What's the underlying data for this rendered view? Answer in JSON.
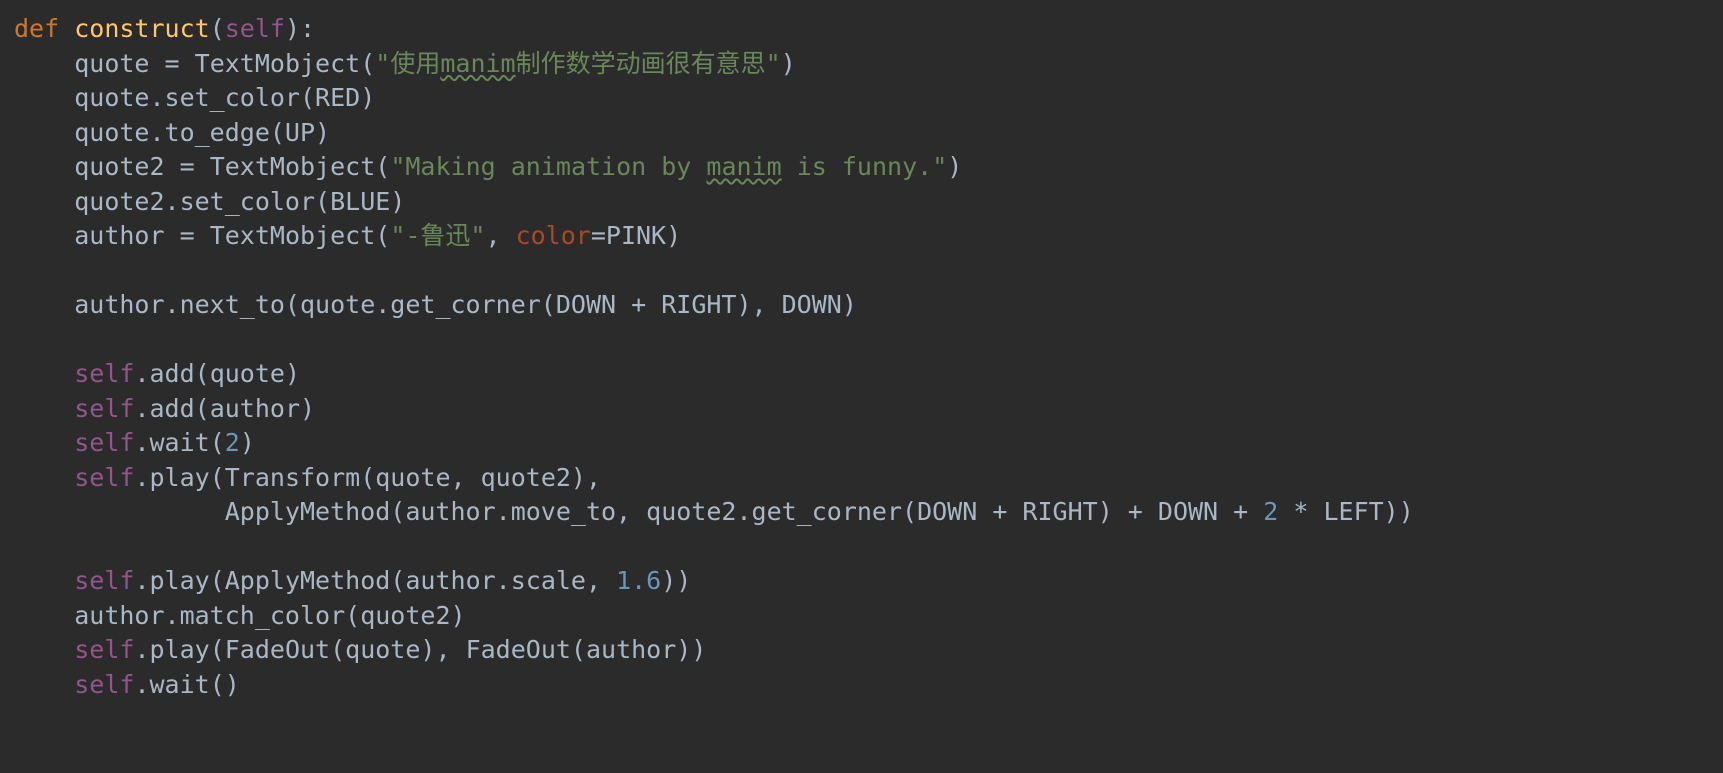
{
  "code": {
    "l1": {
      "kw": "def ",
      "fn": "construct",
      "p1": "(",
      "self": "self",
      "p2": "):"
    },
    "l2": {
      "indent": "    ",
      "v": "quote ",
      "eq": "=",
      "sp": " TextMobject(",
      "s_open": "\"",
      "s_a": "使用",
      "s_squig": "manim",
      "s_b": "制作数学动画很有意思",
      "s_close": "\"",
      "p": ")"
    },
    "l3": {
      "indent": "    ",
      "txt": "quote.set_color(RED)"
    },
    "l4": {
      "indent": "    ",
      "txt": "quote.to_edge(UP)"
    },
    "l5": {
      "indent": "    ",
      "v": "quote2 ",
      "eq": "=",
      "sp": " TextMobject(",
      "s_open": "\"",
      "s_a": "Making animation by ",
      "s_squig": "manim",
      "s_b": " is funny.",
      "s_close": "\"",
      "p": ")"
    },
    "l6": {
      "indent": "    ",
      "txt": "quote2.set_color(BLUE)"
    },
    "l7": {
      "indent": "    ",
      "v": "author ",
      "eq": "=",
      "sp": " TextMobject(",
      "s1": "\"-鲁迅\"",
      "comma": ", ",
      "kwarg": "color",
      "eq2": "=",
      "val": "PINK)"
    },
    "l8": {
      "blank": ""
    },
    "l9": {
      "indent": "    ",
      "txt": "author.next_to(quote.get_corner(DOWN + RIGHT), DOWN)"
    },
    "l10": {
      "blank": ""
    },
    "l11": {
      "indent": "    ",
      "self": "self",
      "rest": ".add(quote)"
    },
    "l12": {
      "indent": "    ",
      "self": "self",
      "rest": ".add(author)"
    },
    "l13": {
      "indent": "    ",
      "self": "self",
      "rest": ".wait(",
      "num": "2",
      "p": ")"
    },
    "l14": {
      "indent": "    ",
      "self": "self",
      "rest": ".play(Transform(quote, quote2),"
    },
    "l15": {
      "indent": "              ",
      "txt": "ApplyMethod(author.move_to, quote2.get_corner(DOWN + RIGHT) + DOWN + ",
      "num": "2",
      "rest2": " * LEFT))"
    },
    "l16": {
      "blank": ""
    },
    "l17": {
      "indent": "    ",
      "self": "self",
      "rest": ".play(ApplyMethod(author.scale, ",
      "num": "1.6",
      "p": "))"
    },
    "l18": {
      "indent": "    ",
      "txt": "author.match_color(quote2)"
    },
    "l19": {
      "indent": "    ",
      "self": "self",
      "rest": ".play(FadeOut(quote), FadeOut(author))"
    },
    "l20": {
      "indent": "    ",
      "self": "self",
      "rest": ".wait()"
    }
  }
}
